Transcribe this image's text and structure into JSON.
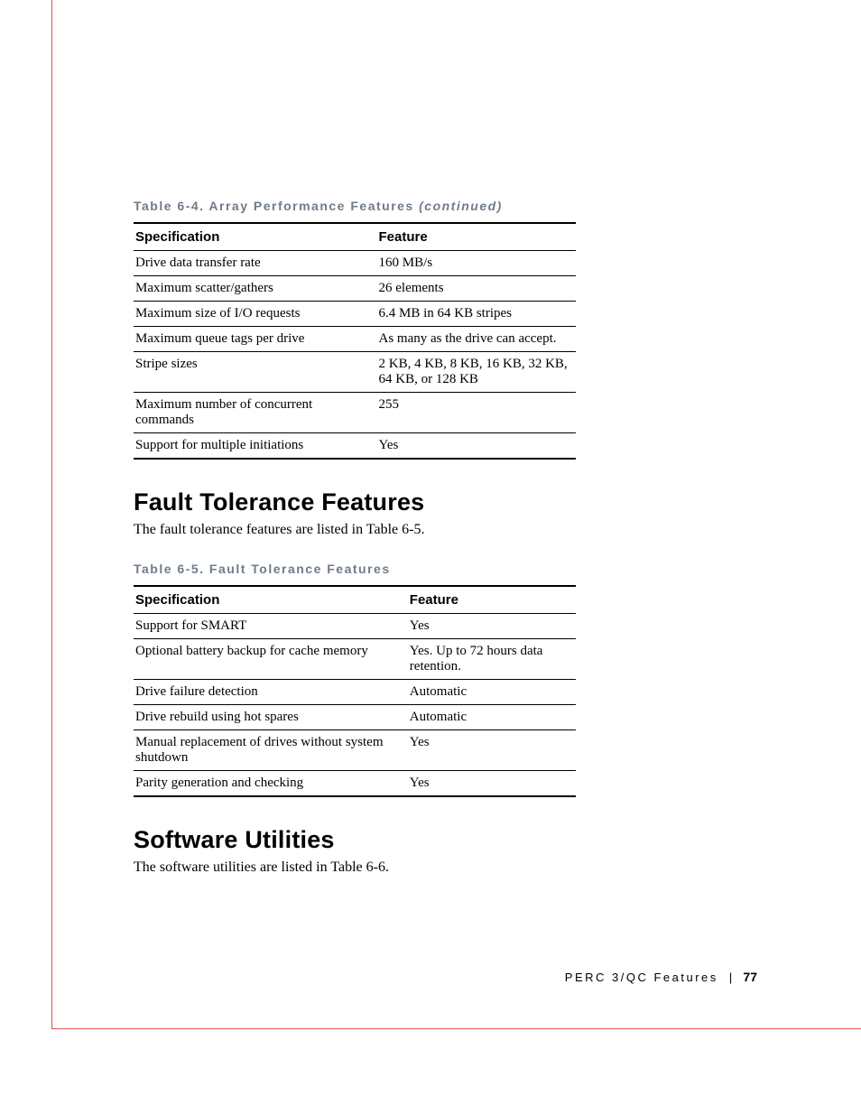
{
  "table64": {
    "caption_main": "Table 6-4. Array Performance Features",
    "caption_cont": "(continued)",
    "col_spec": "Specification",
    "col_feat": "Feature",
    "rows": [
      {
        "spec": "Drive data transfer rate",
        "feat": "160 MB/s"
      },
      {
        "spec": "Maximum scatter/gathers",
        "feat": "26 elements"
      },
      {
        "spec": "Maximum size of I/O requests",
        "feat": "6.4 MB in 64 KB stripes"
      },
      {
        "spec": "Maximum queue tags per drive",
        "feat": "As many as the drive can accept."
      },
      {
        "spec": "Stripe sizes",
        "feat": "2 KB, 4 KB, 8 KB, 16 KB, 32 KB, 64 KB, or 128 KB"
      },
      {
        "spec": "Maximum number of concurrent commands",
        "feat": "255"
      },
      {
        "spec": "Support for multiple initiations",
        "feat": "Yes"
      }
    ]
  },
  "section_fault": {
    "heading": "Fault Tolerance Features",
    "intro": "The fault tolerance features are listed in Table 6-5."
  },
  "table65": {
    "caption": "Table 6-5. Fault Tolerance Features",
    "col_spec": "Specification",
    "col_feat": "Feature",
    "rows": [
      {
        "spec": "Support for SMART",
        "feat": "Yes"
      },
      {
        "spec": "Optional battery backup for cache memory",
        "feat": "Yes. Up to 72 hours data retention."
      },
      {
        "spec": "Drive failure detection",
        "feat": "Automatic"
      },
      {
        "spec": "Drive rebuild using hot spares",
        "feat": "Automatic"
      },
      {
        "spec": "Manual replacement of drives without system shutdown",
        "feat": "Yes"
      },
      {
        "spec": "Parity generation and checking",
        "feat": "Yes"
      }
    ]
  },
  "section_sw": {
    "heading": "Software Utilities",
    "intro": "The software utilities are listed in Table 6-6."
  },
  "footer": {
    "title": "PERC 3/QC Features",
    "page": "77"
  }
}
